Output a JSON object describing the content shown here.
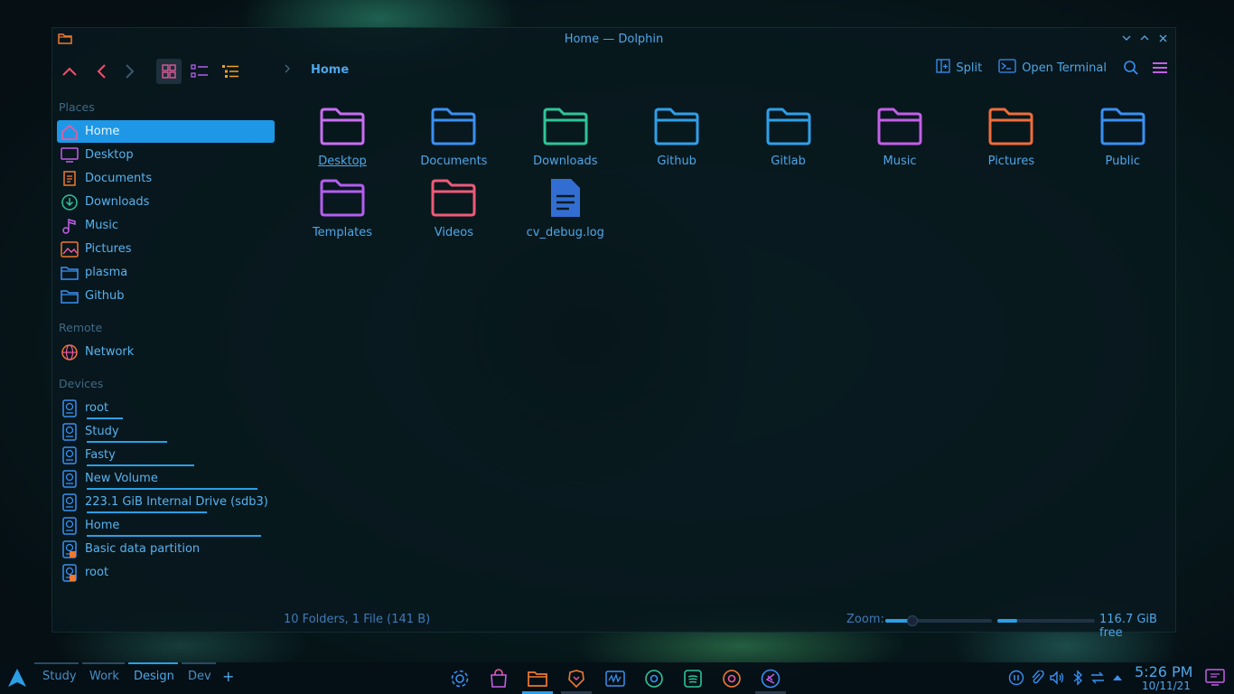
{
  "window": {
    "title": "Home — Dolphin"
  },
  "toolbar": {
    "breadcrumb": "Home",
    "split_label": "Split",
    "terminal_label": "Open Terminal"
  },
  "sidebar": {
    "places_title": "Places",
    "places": [
      {
        "label": "Home",
        "icon": "home-icon",
        "selected": true
      },
      {
        "label": "Desktop",
        "icon": "desktop-icon"
      },
      {
        "label": "Documents",
        "icon": "documents-icon"
      },
      {
        "label": "Downloads",
        "icon": "downloads-icon"
      },
      {
        "label": "Music",
        "icon": "music-icon"
      },
      {
        "label": "Pictures",
        "icon": "pictures-icon"
      },
      {
        "label": "plasma",
        "icon": "folder-icon"
      },
      {
        "label": "Github",
        "icon": "folder-icon"
      }
    ],
    "remote_title": "Remote",
    "remote": [
      {
        "label": "Network",
        "icon": "network-icon"
      }
    ],
    "devices_title": "Devices",
    "devices": [
      {
        "label": "root",
        "usage": 0.19
      },
      {
        "label": "Study",
        "usage": 0.43
      },
      {
        "label": "Fasty",
        "usage": 0.57
      },
      {
        "label": "New Volume",
        "usage": 0.91
      },
      {
        "label": "223.1 GiB Internal Drive (sdb3)",
        "usage": 0.64
      },
      {
        "label": "Home",
        "usage": 0.93
      },
      {
        "label": "Basic data partition"
      },
      {
        "label": "root"
      }
    ]
  },
  "files": [
    {
      "name": "Desktop",
      "type": "folder",
      "color": "#c96ef2",
      "focused": true
    },
    {
      "name": "Documents",
      "type": "folder",
      "color": "#3a8ff2"
    },
    {
      "name": "Downloads",
      "type": "folder",
      "color": "#2fc49a"
    },
    {
      "name": "Github",
      "type": "folder",
      "color": "#2f9fe8"
    },
    {
      "name": "Gitlab",
      "type": "folder",
      "color": "#2f9fe8"
    },
    {
      "name": "Music",
      "type": "folder",
      "color": "#c45ee8"
    },
    {
      "name": "Pictures",
      "type": "folder",
      "color": "#ef6d3b"
    },
    {
      "name": "Public",
      "type": "folder",
      "color": "#3a8ff2"
    },
    {
      "name": "Templates",
      "type": "folder",
      "color": "#b45ef0"
    },
    {
      "name": "Videos",
      "type": "folder",
      "color": "#ef5a78"
    },
    {
      "name": "cv_debug.log",
      "type": "file",
      "color": "#3a7ef2"
    }
  ],
  "status": {
    "summary": "10 Folders, 1 File (141 B)",
    "zoom_label": "Zoom:",
    "zoom_level": 0.25,
    "disk_used_fraction": 0.2,
    "free_space": "116.7 GiB free"
  },
  "taskbar": {
    "desktops": [
      "Study",
      "Work",
      "Design",
      "Dev"
    ],
    "active_desktop": "Design",
    "add_label": "+",
    "apps": [
      "settings-icon",
      "store-icon",
      "dolphin-icon",
      "brave-icon",
      "waveform-icon",
      "chrome-icon",
      "spotify-icon",
      "chrome-icon",
      "vscode-icon"
    ],
    "clock_time": "5:26 PM",
    "clock_date": "10/11/21"
  }
}
